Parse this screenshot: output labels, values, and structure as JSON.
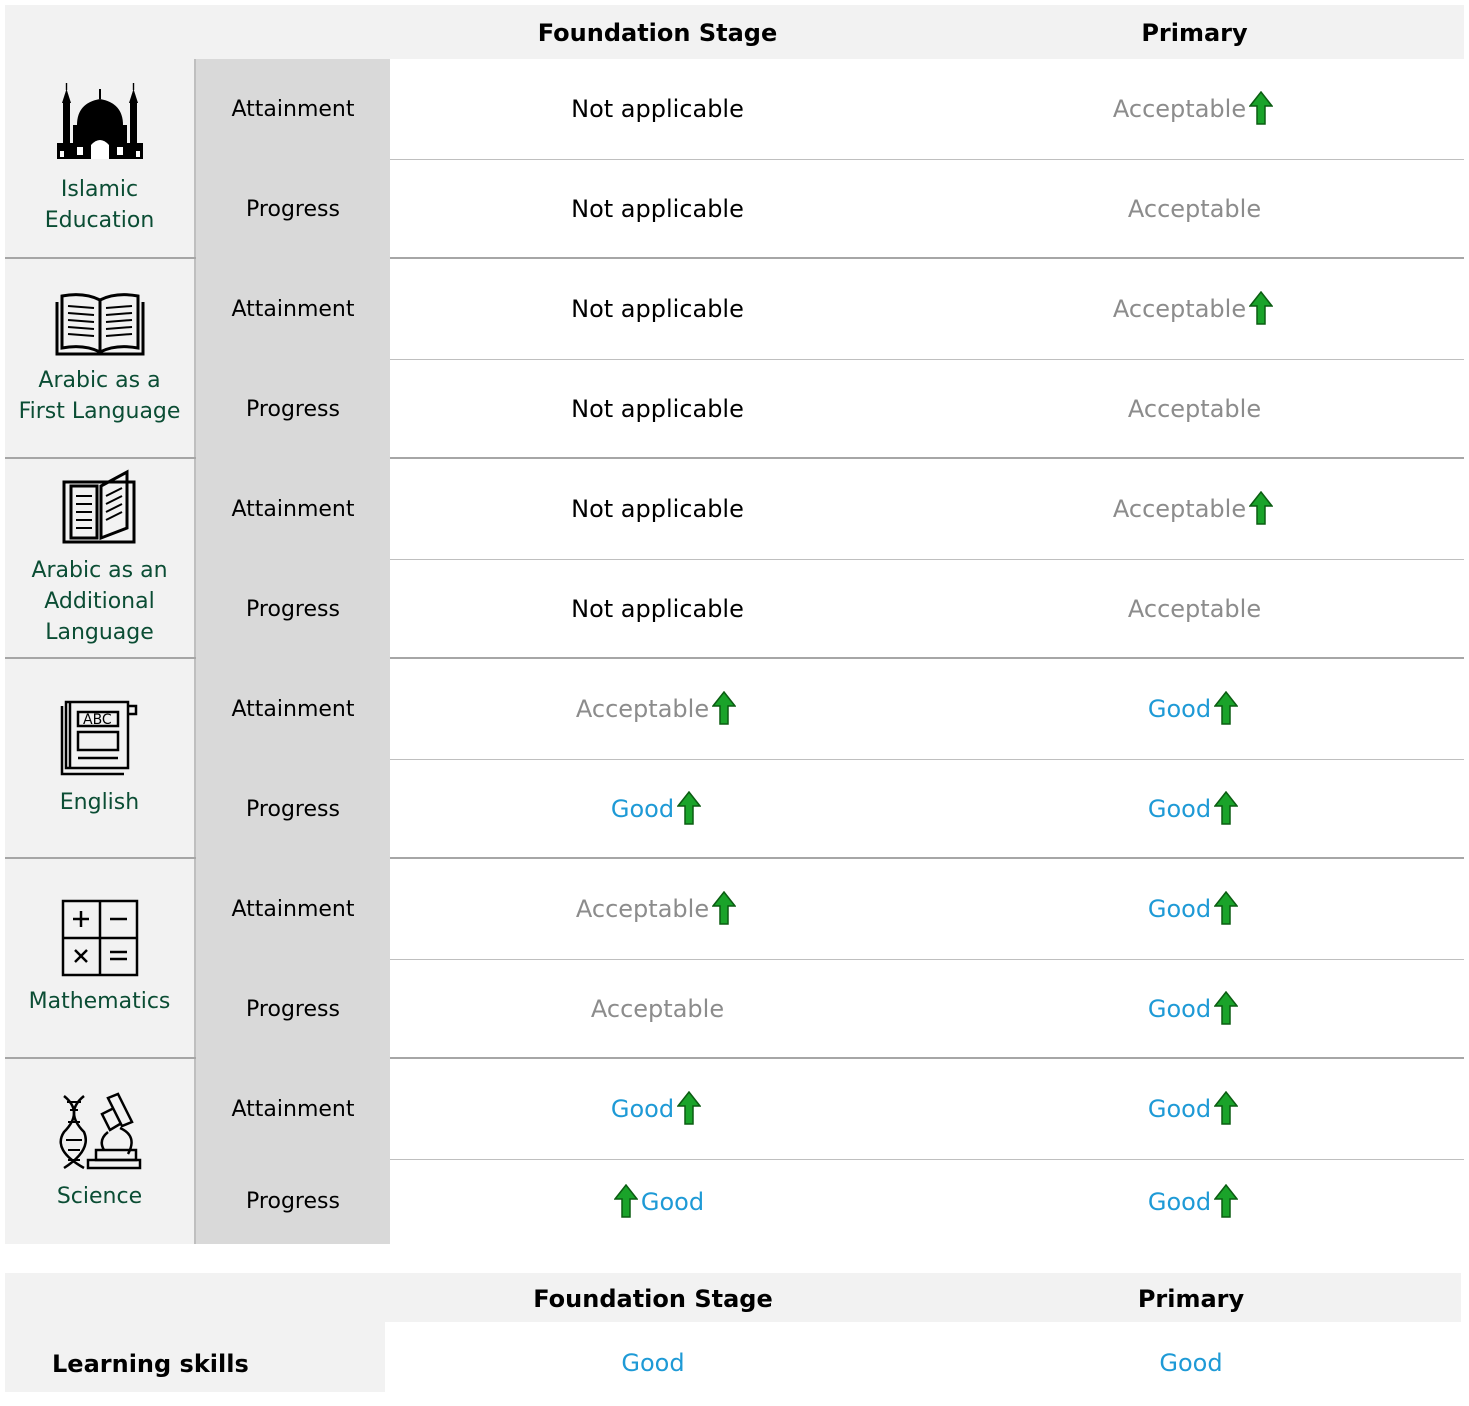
{
  "header": {
    "col1": "Foundation Stage",
    "col2": "Primary"
  },
  "subjects": [
    {
      "name": "Islamic Education",
      "icon": "mosque-icon",
      "rows": [
        {
          "measure": "Attainment",
          "fs": "Not applicable",
          "fs_class": "na",
          "fs_arrow": "",
          "primary": "Acceptable",
          "primary_class": "acc",
          "primary_arrow": "after"
        },
        {
          "measure": "Progress",
          "fs": "Not applicable",
          "fs_class": "na",
          "fs_arrow": "",
          "primary": "Acceptable",
          "primary_class": "acc",
          "primary_arrow": ""
        }
      ]
    },
    {
      "name": "Arabic as a First Language",
      "icon": "open-book-icon",
      "rows": [
        {
          "measure": "Attainment",
          "fs": "Not applicable",
          "fs_class": "na",
          "fs_arrow": "",
          "primary": "Acceptable",
          "primary_class": "acc",
          "primary_arrow": "after"
        },
        {
          "measure": "Progress",
          "fs": "Not applicable",
          "fs_class": "na",
          "fs_arrow": "",
          "primary": "Acceptable",
          "primary_class": "acc",
          "primary_arrow": ""
        }
      ]
    },
    {
      "name": "Arabic as an Additional Language",
      "icon": "book-icon",
      "rows": [
        {
          "measure": "Attainment",
          "fs": "Not applicable",
          "fs_class": "na",
          "fs_arrow": "",
          "primary": "Acceptable",
          "primary_class": "acc",
          "primary_arrow": "after"
        },
        {
          "measure": "Progress",
          "fs": "Not applicable",
          "fs_class": "na",
          "fs_arrow": "",
          "primary": "Acceptable",
          "primary_class": "acc",
          "primary_arrow": ""
        }
      ]
    },
    {
      "name": "English",
      "icon": "abc-book-icon",
      "rows": [
        {
          "measure": "Attainment",
          "fs": "Acceptable",
          "fs_class": "acc",
          "fs_arrow": "after",
          "primary": "Good",
          "primary_class": "good",
          "primary_arrow": "after"
        },
        {
          "measure": "Progress",
          "fs": "Good",
          "fs_class": "good",
          "fs_arrow": "after",
          "primary": "Good",
          "primary_class": "good",
          "primary_arrow": "after"
        }
      ]
    },
    {
      "name": "Mathematics",
      "icon": "math-operations-icon",
      "rows": [
        {
          "measure": "Attainment",
          "fs": "Acceptable",
          "fs_class": "acc",
          "fs_arrow": "after",
          "primary": "Good",
          "primary_class": "good",
          "primary_arrow": "after"
        },
        {
          "measure": "Progress",
          "fs": "Acceptable",
          "fs_class": "acc",
          "fs_arrow": "",
          "primary": "Good",
          "primary_class": "good",
          "primary_arrow": "after"
        }
      ]
    },
    {
      "name": "Science",
      "icon": "dna-microscope-icon",
      "rows": [
        {
          "measure": "Attainment",
          "fs": "Good",
          "fs_class": "good",
          "fs_arrow": "after",
          "primary": "Good",
          "primary_class": "good",
          "primary_arrow": "after"
        },
        {
          "measure": "Progress",
          "fs": "Good",
          "fs_class": "good",
          "fs_arrow": "before",
          "primary": "Good",
          "primary_class": "good",
          "primary_arrow": "after"
        }
      ]
    }
  ],
  "learning_skills": {
    "header": {
      "col1": "Foundation Stage",
      "col2": "Primary"
    },
    "label": "Learning skills",
    "fs": "Good",
    "primary": "Good"
  },
  "colors": {
    "subject_label": "#0b4d34",
    "acceptable": "#8c8c8c",
    "good": "#1e9ad6",
    "arrow": "#1aa32a"
  }
}
